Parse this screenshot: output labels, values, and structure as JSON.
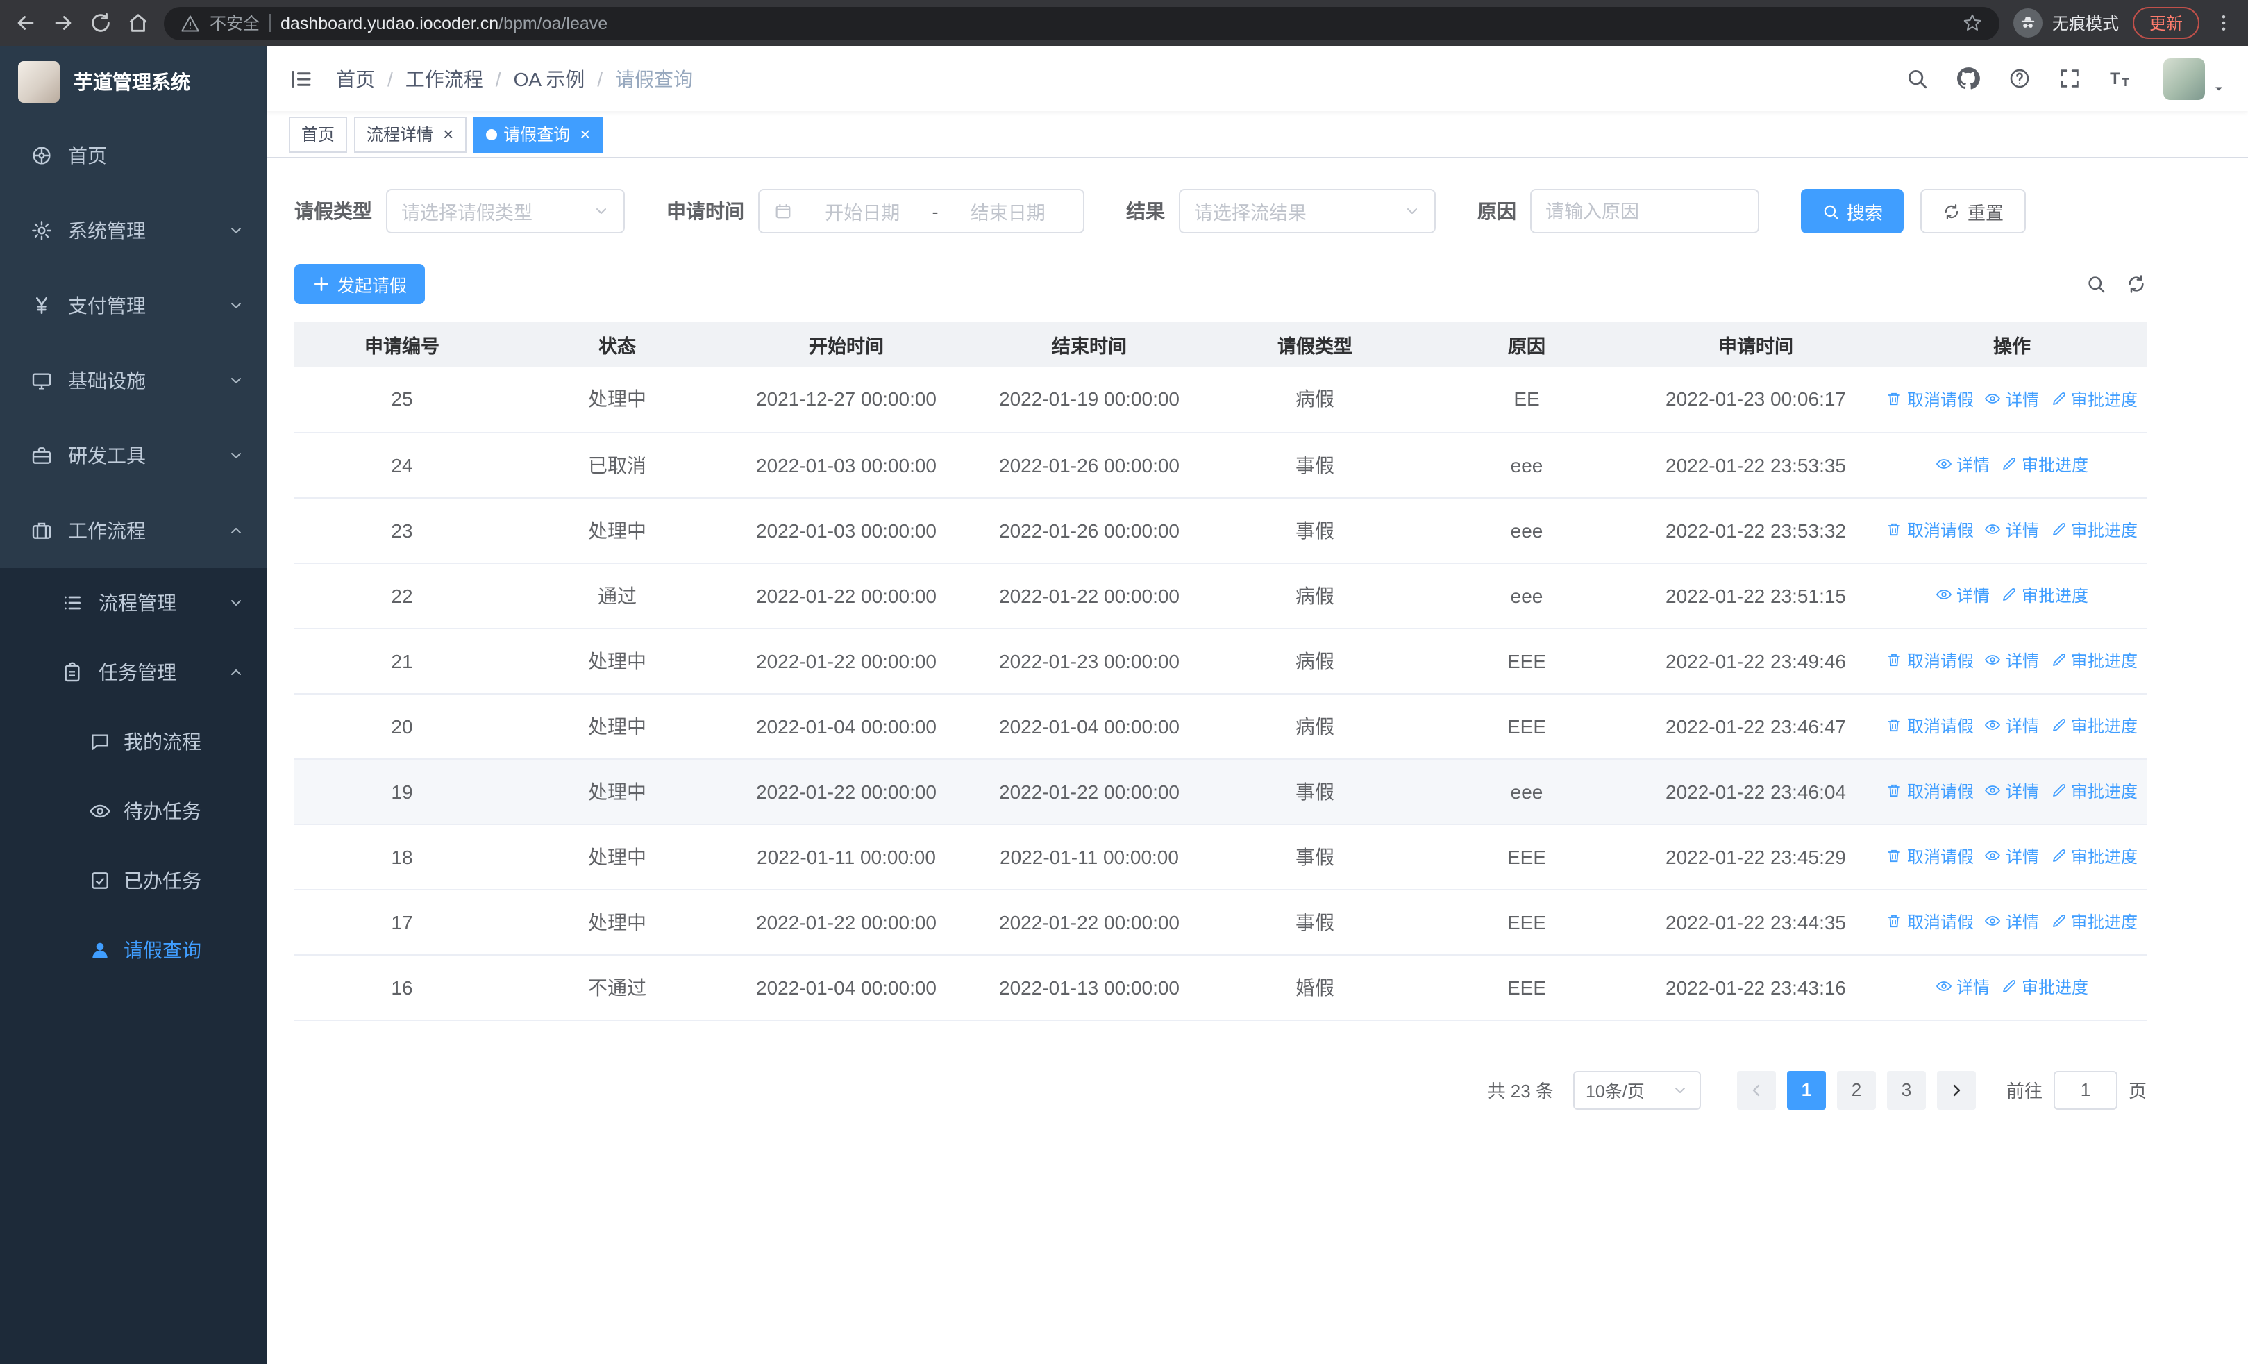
{
  "browser": {
    "warning": "不安全",
    "url_domain": "dashboard.yudao.iocoder.cn",
    "url_path": "/bpm/oa/leave",
    "incognito": "无痕模式",
    "update": "更新"
  },
  "sidebar": {
    "title": "芋道管理系统",
    "menu": [
      {
        "name": "home",
        "label": "首页",
        "icon": "dashboard",
        "level": 1
      },
      {
        "name": "system-management",
        "label": "系统管理",
        "icon": "gear",
        "level": 1,
        "chevron": "down"
      },
      {
        "name": "payment-management",
        "label": "支付管理",
        "icon": "yen",
        "level": 1,
        "chevron": "down"
      },
      {
        "name": "infrastructure",
        "label": "基础设施",
        "icon": "monitor",
        "level": 1,
        "chevron": "down"
      },
      {
        "name": "dev-tools",
        "label": "研发工具",
        "icon": "briefcase",
        "level": 1,
        "chevron": "down"
      },
      {
        "name": "workflow",
        "label": "工作流程",
        "icon": "suitcase",
        "level": 1,
        "chevron": "up",
        "open": true
      },
      {
        "name": "process-management",
        "label": "流程管理",
        "icon": "list",
        "level": 2,
        "chevron": "down"
      },
      {
        "name": "task-management",
        "label": "任务管理",
        "icon": "clipboard",
        "level": 2,
        "chevron": "up",
        "open": true
      },
      {
        "name": "my-processes",
        "label": "我的流程",
        "icon": "chat",
        "level": 3
      },
      {
        "name": "todo-tasks",
        "label": "待办任务",
        "icon": "eye",
        "level": 3
      },
      {
        "name": "done-tasks",
        "label": "已办任务",
        "icon": "check-square",
        "level": 3
      },
      {
        "name": "leave-query",
        "label": "请假查询",
        "icon": "user",
        "level": 3,
        "active": true
      }
    ]
  },
  "navbar": {
    "breadcrumb": [
      "首页",
      "工作流程",
      "OA 示例",
      "请假查询"
    ]
  },
  "tabs": [
    {
      "name": "home",
      "label": "首页"
    },
    {
      "name": "process-detail",
      "label": "流程详情",
      "closable": true
    },
    {
      "name": "leave-query",
      "label": "请假查询",
      "closable": true,
      "active": true
    }
  ],
  "filters": {
    "type_label": "请假类型",
    "type_placeholder": "请选择请假类型",
    "time_label": "申请时间",
    "start_placeholder": "开始日期",
    "range_separator": "-",
    "end_placeholder": "结束日期",
    "result_label": "结果",
    "result_placeholder": "请选择流结果",
    "reason_label": "原因",
    "reason_placeholder": "请输入原因",
    "search": "搜索",
    "reset": "重置"
  },
  "toolbar": {
    "create": "发起请假"
  },
  "table": {
    "columns": [
      "申请编号",
      "状态",
      "开始时间",
      "结束时间",
      "请假类型",
      "原因",
      "申请时间",
      "操作"
    ],
    "action_labels": {
      "cancel": "取消请假",
      "detail": "详情",
      "progress": "审批进度"
    },
    "rows": [
      {
        "id": "25",
        "status": "处理中",
        "start": "2021-12-27 00:00:00",
        "end": "2022-01-19 00:00:00",
        "type": "病假",
        "reason": "EE",
        "applied": "2022-01-23 00:06:17",
        "actions": [
          "cancel",
          "detail",
          "progress"
        ]
      },
      {
        "id": "24",
        "status": "已取消",
        "start": "2022-01-03 00:00:00",
        "end": "2022-01-26 00:00:00",
        "type": "事假",
        "reason": "eee",
        "applied": "2022-01-22 23:53:35",
        "actions": [
          "detail",
          "progress"
        ]
      },
      {
        "id": "23",
        "status": "处理中",
        "start": "2022-01-03 00:00:00",
        "end": "2022-01-26 00:00:00",
        "type": "事假",
        "reason": "eee",
        "applied": "2022-01-22 23:53:32",
        "actions": [
          "cancel",
          "detail",
          "progress"
        ]
      },
      {
        "id": "22",
        "status": "通过",
        "start": "2022-01-22 00:00:00",
        "end": "2022-01-22 00:00:00",
        "type": "病假",
        "reason": "eee",
        "applied": "2022-01-22 23:51:15",
        "actions": [
          "detail",
          "progress"
        ]
      },
      {
        "id": "21",
        "status": "处理中",
        "start": "2022-01-22 00:00:00",
        "end": "2022-01-23 00:00:00",
        "type": "病假",
        "reason": "EEE",
        "applied": "2022-01-22 23:49:46",
        "actions": [
          "cancel",
          "detail",
          "progress"
        ]
      },
      {
        "id": "20",
        "status": "处理中",
        "start": "2022-01-04 00:00:00",
        "end": "2022-01-04 00:00:00",
        "type": "病假",
        "reason": "EEE",
        "applied": "2022-01-22 23:46:47",
        "actions": [
          "cancel",
          "detail",
          "progress"
        ]
      },
      {
        "id": "19",
        "status": "处理中",
        "start": "2022-01-22 00:00:00",
        "end": "2022-01-22 00:00:00",
        "type": "事假",
        "reason": "eee",
        "applied": "2022-01-22 23:46:04",
        "actions": [
          "cancel",
          "detail",
          "progress"
        ],
        "hover": true
      },
      {
        "id": "18",
        "status": "处理中",
        "start": "2022-01-11 00:00:00",
        "end": "2022-01-11 00:00:00",
        "type": "事假",
        "reason": "EEE",
        "applied": "2022-01-22 23:45:29",
        "actions": [
          "cancel",
          "detail",
          "progress"
        ]
      },
      {
        "id": "17",
        "status": "处理中",
        "start": "2022-01-22 00:00:00",
        "end": "2022-01-22 00:00:00",
        "type": "事假",
        "reason": "EEE",
        "applied": "2022-01-22 23:44:35",
        "actions": [
          "cancel",
          "detail",
          "progress"
        ]
      },
      {
        "id": "16",
        "status": "不通过",
        "start": "2022-01-04 00:00:00",
        "end": "2022-01-13 00:00:00",
        "type": "婚假",
        "reason": "EEE",
        "applied": "2022-01-22 23:43:16",
        "actions": [
          "detail",
          "progress"
        ]
      }
    ]
  },
  "pagination": {
    "total": "共 23 条",
    "page_size": "10条/页",
    "pages": [
      "1",
      "2",
      "3"
    ],
    "current": "1",
    "goto": "前往",
    "goto_value": "1",
    "unit": "页"
  },
  "colors": {
    "primary": "#409eff",
    "sidebar_bg": "#1d2a39",
    "header_bg": "#f0f2f5"
  }
}
